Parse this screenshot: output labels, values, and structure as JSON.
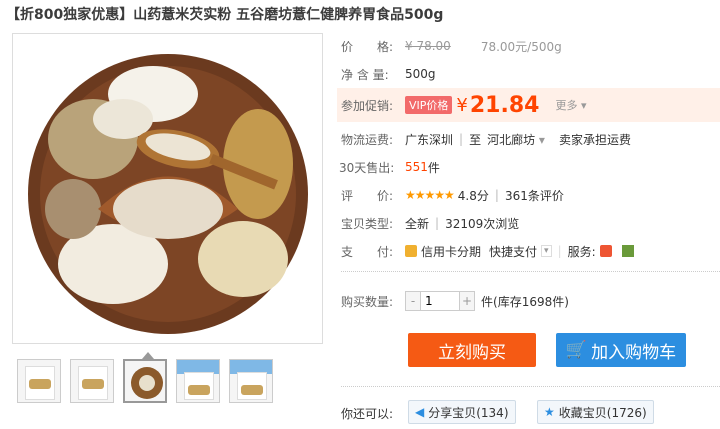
{
  "title": "【折800独家优惠】山药薏米芡实粉 五谷磨坊薏仁健脾养胃食品500g",
  "price": {
    "label": "价　　格:",
    "old": "¥ 78.00",
    "unit_price": "78.00元/500g"
  },
  "net_weight": {
    "label": "净 含 量:",
    "value": "500g"
  },
  "promo": {
    "label": "参加促销:",
    "vip_tag": "VIP价格",
    "yen": "¥",
    "price": "21.84",
    "more": "更多"
  },
  "shipping": {
    "label": "物流运费:",
    "from": "广东深圳",
    "to_prefix": "至",
    "to": "河北廊坊",
    "fee": "卖家承担运费"
  },
  "sales": {
    "label": "30天售出:",
    "count": "551",
    "unit": "件"
  },
  "rating": {
    "label": "评　　价:",
    "stars": "★★★★★",
    "score": "4.8分",
    "reviews": "361条评价"
  },
  "item_type": {
    "label": "宝贝类型:",
    "condition": "全新",
    "views": "32109次浏览"
  },
  "payment": {
    "label": "支　　付:",
    "card": "信用卡分期",
    "fast": "快捷支付",
    "service_label": "服务:"
  },
  "quantity": {
    "label": "购买数量:",
    "value": "1",
    "unit": "件",
    "stock": "(库存1698件)"
  },
  "buttons": {
    "buy": "立刻购买",
    "cart": "加入购物车"
  },
  "share": {
    "label": "你还可以:",
    "share_btn": "分享宝贝(134)",
    "fav_btn": "收藏宝贝(1726)"
  },
  "colors": {
    "accent": "#ff4400",
    "buy": "#f55a14",
    "cart": "#2c8ee0"
  }
}
